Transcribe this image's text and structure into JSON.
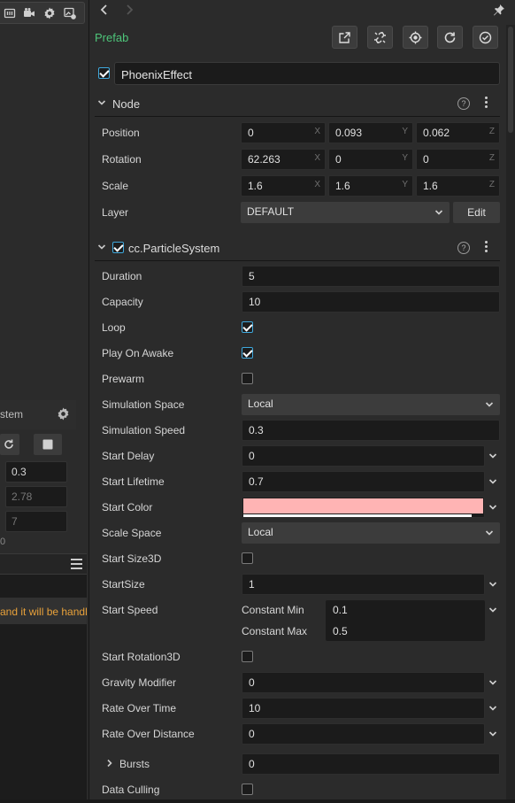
{
  "left_panel": {
    "toolbar_icons": [
      "grid-icon",
      "video-camera-icon",
      "gear-icon",
      "image-settings-icon"
    ],
    "section_title": "stem",
    "values": [
      "0.3",
      "2.78",
      "7"
    ],
    "small_value": "0",
    "console_warning": "and it will be handl"
  },
  "inspector": {
    "prefab_label": "Prefab",
    "prefab_buttons": [
      "open-external-icon",
      "unlink-icon",
      "locate-icon",
      "revert-icon",
      "apply-icon"
    ],
    "node_name": "PhoenixEffect",
    "node_section": {
      "title": "Node",
      "position": {
        "label": "Position",
        "x": "0",
        "y": "0.093",
        "z": "0.062"
      },
      "rotation": {
        "label": "Rotation",
        "x": "62.263",
        "y": "0",
        "z": "0"
      },
      "scale": {
        "label": "Scale",
        "x": "1.6",
        "y": "1.6",
        "z": "1.6"
      },
      "layer": {
        "label": "Layer",
        "value": "DEFAULT",
        "edit_label": "Edit"
      },
      "axis_x": "X",
      "axis_y": "Y",
      "axis_z": "Z"
    },
    "component": {
      "title": "cc.ParticleSystem",
      "rows": {
        "duration": {
          "label": "Duration",
          "value": "5"
        },
        "capacity": {
          "label": "Capacity",
          "value": "10"
        },
        "loop": {
          "label": "Loop",
          "checked": true
        },
        "play_on_awake": {
          "label": "Play On Awake",
          "checked": true
        },
        "prewarm": {
          "label": "Prewarm",
          "checked": false
        },
        "simulation_space": {
          "label": "Simulation Space",
          "value": "Local"
        },
        "simulation_speed": {
          "label": "Simulation Speed",
          "value": "0.3"
        },
        "start_delay": {
          "label": "Start Delay",
          "value": "0"
        },
        "start_lifetime": {
          "label": "Start Lifetime",
          "value": "0.7"
        },
        "start_color": {
          "label": "Start Color",
          "color": "#ffb4b4"
        },
        "scale_space": {
          "label": "Scale Space",
          "value": "Local"
        },
        "start_size3d": {
          "label": "Start Size3D",
          "checked": false
        },
        "start_size": {
          "label": "StartSize",
          "value": "1"
        },
        "start_speed": {
          "label": "Start Speed",
          "min_label": "Constant Min",
          "min_value": "0.1",
          "max_label": "Constant Max",
          "max_value": "0.5"
        },
        "start_rotation3d": {
          "label": "Start Rotation3D",
          "checked": false
        },
        "gravity_modifier": {
          "label": "Gravity Modifier",
          "value": "0"
        },
        "rate_over_time": {
          "label": "Rate Over Time",
          "value": "10"
        },
        "rate_over_distance": {
          "label": "Rate Over Distance",
          "value": "0"
        },
        "bursts": {
          "label": "Bursts",
          "value": "0"
        },
        "data_culling": {
          "label": "Data Culling",
          "checked": false
        }
      }
    },
    "colors": {
      "prefab": "#4ec57a",
      "check_accent": "#3fa8dc",
      "warning": "#e8a13a"
    }
  }
}
